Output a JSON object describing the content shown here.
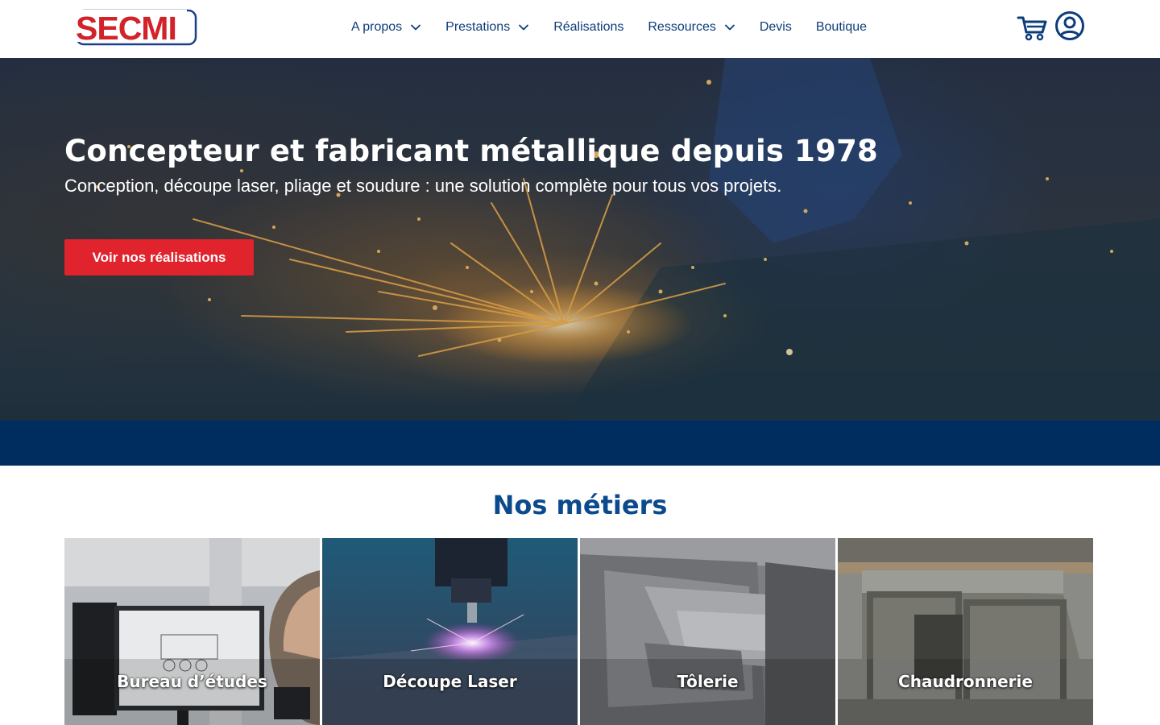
{
  "brand": {
    "logo_text": "SECMI",
    "primary_color": "#0d3c7a",
    "accent_color": "#e0232c",
    "band_color": "#002d5f"
  },
  "nav": {
    "items": [
      {
        "label": "A propos",
        "has_dropdown": true
      },
      {
        "label": "Prestations",
        "has_dropdown": true
      },
      {
        "label": "Réalisations",
        "has_dropdown": false
      },
      {
        "label": "Ressources",
        "has_dropdown": true
      },
      {
        "label": "Devis",
        "has_dropdown": false
      },
      {
        "label": "Boutique",
        "has_dropdown": false
      }
    ],
    "icons": [
      "cart-icon",
      "user-account-icon"
    ]
  },
  "hero": {
    "title": "Concepteur et fabricant métallique depuis 1978",
    "subtitle": "Conception, découpe laser, pliage et soudure : une solution complète pour tous vos projets.",
    "cta_label": "Voir nos réalisations"
  },
  "metiers": {
    "title": "Nos métiers",
    "cards": [
      {
        "label": "Bureau d’études"
      },
      {
        "label": "Découpe Laser"
      },
      {
        "label": "Tôlerie"
      },
      {
        "label": "Chaudronnerie"
      }
    ]
  }
}
